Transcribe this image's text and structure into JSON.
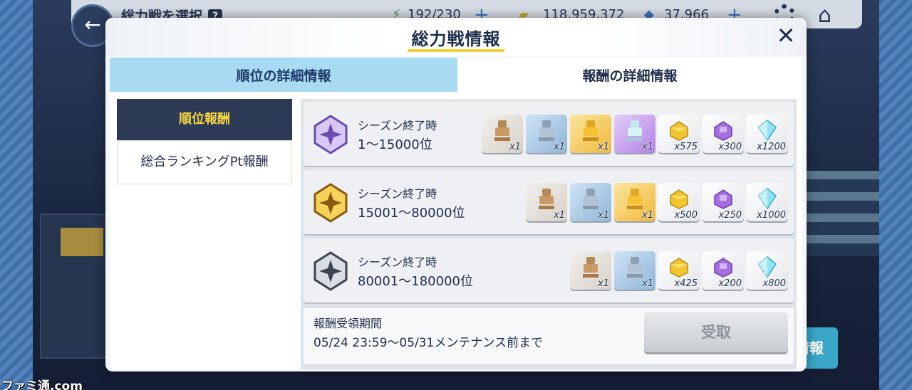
{
  "background": {
    "screen_title": "総力戦を選択",
    "help_mark": "?",
    "stamina": "192/230",
    "credits": "118,959,372",
    "gems": "37,966",
    "side_button": "情報",
    "watermark": "ファミ通.com"
  },
  "modal": {
    "title": "総力戦情報",
    "close_symbol": "✕",
    "tabs": {
      "rank_detail": "順位の詳細情報",
      "reward_detail": "報酬の詳細情報"
    },
    "active_tab": "reward_detail",
    "side_menu": {
      "rank_reward": "順位報酬",
      "total_ranking_reward": "総合ランキングPt報酬"
    },
    "rank_rows": [
      {
        "condition": "シーズン終了時",
        "range": "1〜15000位",
        "emblem": "purple-emblem-icon",
        "items": [
          {
            "icon": "bronze-robot-figure-icon",
            "color": "bronze",
            "qty": "x1"
          },
          {
            "icon": "silver-robot-figure-icon",
            "color": "silver",
            "qty": "x1"
          },
          {
            "icon": "gold-robot-figure-icon",
            "color": "gold",
            "qty": "x1"
          },
          {
            "icon": "rainbow-robot-figure-icon",
            "color": "purple",
            "qty": "x1"
          },
          {
            "icon": "gold-ingot-icon",
            "color": "plain",
            "qty": "x575"
          },
          {
            "icon": "purple-chip-icon",
            "color": "plain",
            "qty": "x300"
          },
          {
            "icon": "blue-crystal-icon",
            "color": "plain",
            "qty": "x1200"
          }
        ]
      },
      {
        "condition": "シーズン終了時",
        "range": "15001〜80000位",
        "emblem": "gold-emblem-icon",
        "items": [
          {
            "icon": "bronze-robot-figure-icon",
            "color": "bronze",
            "qty": "x1"
          },
          {
            "icon": "silver-robot-figure-icon",
            "color": "silver",
            "qty": "x1"
          },
          {
            "icon": "gold-robot-figure-icon",
            "color": "gold",
            "qty": "x1"
          },
          {
            "icon": "gold-ingot-icon",
            "color": "plain",
            "qty": "x500"
          },
          {
            "icon": "purple-chip-icon",
            "color": "plain",
            "qty": "x250"
          },
          {
            "icon": "blue-crystal-icon",
            "color": "plain",
            "qty": "x1000"
          }
        ]
      },
      {
        "condition": "シーズン終了時",
        "range": "80001〜180000位",
        "emblem": "silver-emblem-icon",
        "items": [
          {
            "icon": "bronze-robot-figure-icon",
            "color": "bronze",
            "qty": "x1"
          },
          {
            "icon": "silver-robot-figure-icon",
            "color": "silver",
            "qty": "x1"
          },
          {
            "icon": "gold-ingot-icon",
            "color": "plain",
            "qty": "x425"
          },
          {
            "icon": "purple-chip-icon",
            "color": "plain",
            "qty": "x200"
          },
          {
            "icon": "blue-crystal-icon",
            "color": "plain",
            "qty": "x800"
          }
        ]
      }
    ],
    "claim_period": {
      "label": "報酬受領期間",
      "value": "05/24 23:59〜05/31メンテナンス前まで"
    },
    "claim_button": "受取",
    "colors": {
      "tab_active_bg": "#a8dbf2",
      "side_active_bg": "#2d3a56",
      "side_active_text": "#f5d540",
      "title_underline": "#f2d13a"
    }
  }
}
